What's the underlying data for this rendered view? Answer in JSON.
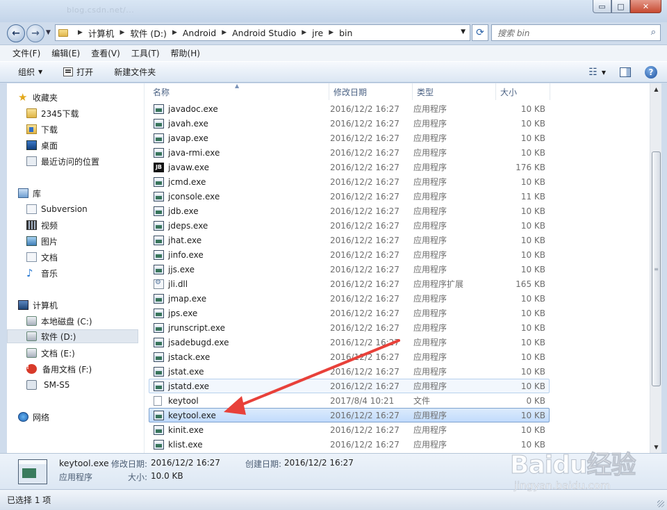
{
  "window": {
    "faint_url": "blog.csdn.net/...",
    "controls": {
      "minimize": "▭",
      "maximize": "□",
      "close": "✕"
    }
  },
  "address": {
    "crumbs": [
      "计算机",
      "软件 (D:)",
      "Android",
      "Android Studio",
      "jre",
      "bin"
    ],
    "search_placeholder": "搜索 bin"
  },
  "menu": [
    "文件(F)",
    "编辑(E)",
    "查看(V)",
    "工具(T)",
    "帮助(H)"
  ],
  "toolbar": {
    "organize": "组织",
    "open": "打开",
    "new_folder": "新建文件夹"
  },
  "nav": {
    "favorites_label": "收藏夹",
    "favorites": [
      "2345下载",
      "下载",
      "桌面",
      "最近访问的位置"
    ],
    "libraries_label": "库",
    "libraries": [
      "Subversion",
      "视频",
      "图片",
      "文档",
      "音乐"
    ],
    "computer_label": "计算机",
    "drives": [
      "本地磁盘 (C:)",
      "软件 (D:)",
      "文档 (E:)",
      "备用文档 (F:)",
      "SM-S5"
    ],
    "network_label": "网络"
  },
  "columns": {
    "name": "名称",
    "date": "修改日期",
    "type": "类型",
    "size": "大小"
  },
  "files": [
    {
      "name": "javadoc.exe",
      "date": "2016/12/2 16:27",
      "type": "应用程序",
      "size": "10 KB",
      "icon": "exe-icon"
    },
    {
      "name": "javah.exe",
      "date": "2016/12/2 16:27",
      "type": "应用程序",
      "size": "10 KB",
      "icon": "exe-icon"
    },
    {
      "name": "javap.exe",
      "date": "2016/12/2 16:27",
      "type": "应用程序",
      "size": "10 KB",
      "icon": "exe-icon"
    },
    {
      "name": "java-rmi.exe",
      "date": "2016/12/2 16:27",
      "type": "应用程序",
      "size": "10 KB",
      "icon": "exe-icon"
    },
    {
      "name": "javaw.exe",
      "date": "2016/12/2 16:27",
      "type": "应用程序",
      "size": "176 KB",
      "icon": "jb-icon"
    },
    {
      "name": "jcmd.exe",
      "date": "2016/12/2 16:27",
      "type": "应用程序",
      "size": "10 KB",
      "icon": "exe-icon"
    },
    {
      "name": "jconsole.exe",
      "date": "2016/12/2 16:27",
      "type": "应用程序",
      "size": "11 KB",
      "icon": "exe-icon"
    },
    {
      "name": "jdb.exe",
      "date": "2016/12/2 16:27",
      "type": "应用程序",
      "size": "10 KB",
      "icon": "exe-icon"
    },
    {
      "name": "jdeps.exe",
      "date": "2016/12/2 16:27",
      "type": "应用程序",
      "size": "10 KB",
      "icon": "exe-icon"
    },
    {
      "name": "jhat.exe",
      "date": "2016/12/2 16:27",
      "type": "应用程序",
      "size": "10 KB",
      "icon": "exe-icon"
    },
    {
      "name": "jinfo.exe",
      "date": "2016/12/2 16:27",
      "type": "应用程序",
      "size": "10 KB",
      "icon": "exe-icon"
    },
    {
      "name": "jjs.exe",
      "date": "2016/12/2 16:27",
      "type": "应用程序",
      "size": "10 KB",
      "icon": "exe-icon"
    },
    {
      "name": "jli.dll",
      "date": "2016/12/2 16:27",
      "type": "应用程序扩展",
      "size": "165 KB",
      "icon": "dll-icon"
    },
    {
      "name": "jmap.exe",
      "date": "2016/12/2 16:27",
      "type": "应用程序",
      "size": "10 KB",
      "icon": "exe-icon"
    },
    {
      "name": "jps.exe",
      "date": "2016/12/2 16:27",
      "type": "应用程序",
      "size": "10 KB",
      "icon": "exe-icon"
    },
    {
      "name": "jrunscript.exe",
      "date": "2016/12/2 16:27",
      "type": "应用程序",
      "size": "10 KB",
      "icon": "exe-icon"
    },
    {
      "name": "jsadebugd.exe",
      "date": "2016/12/2 16:27",
      "type": "应用程序",
      "size": "10 KB",
      "icon": "exe-icon"
    },
    {
      "name": "jstack.exe",
      "date": "2016/12/2 16:27",
      "type": "应用程序",
      "size": "10 KB",
      "icon": "exe-icon"
    },
    {
      "name": "jstat.exe",
      "date": "2016/12/2 16:27",
      "type": "应用程序",
      "size": "10 KB",
      "icon": "exe-icon"
    },
    {
      "name": "jstatd.exe",
      "date": "2016/12/2 16:27",
      "type": "应用程序",
      "size": "10 KB",
      "icon": "exe-icon"
    },
    {
      "name": "keytool",
      "date": "2017/8/4 10:21",
      "type": "文件",
      "size": "0 KB",
      "icon": "blank-file-icon"
    },
    {
      "name": "keytool.exe",
      "date": "2016/12/2 16:27",
      "type": "应用程序",
      "size": "10 KB",
      "icon": "exe-icon"
    },
    {
      "name": "kinit.exe",
      "date": "2016/12/2 16:27",
      "type": "应用程序",
      "size": "10 KB",
      "icon": "exe-icon"
    },
    {
      "name": "klist.exe",
      "date": "2016/12/2 16:27",
      "type": "应用程序",
      "size": "10 KB",
      "icon": "exe-icon"
    }
  ],
  "hovered_file": "jstatd.exe",
  "selected_file": "keytool.exe",
  "details": {
    "name": "keytool.exe",
    "modified_label": "修改日期:",
    "modified": "2016/12/2 16:27",
    "created_label": "创建日期:",
    "created": "2016/12/2 16:27",
    "type": "应用程序",
    "size_label": "大小:",
    "size": "10.0 KB"
  },
  "status": "已选择 1 项",
  "watermark": {
    "brand": "Baidu经验",
    "sub": "jingyan.baidu.com"
  },
  "colors": {
    "annotation_arrow": "#e8413a",
    "selection": "#c1dbfc",
    "header_text": "#4b6284"
  }
}
